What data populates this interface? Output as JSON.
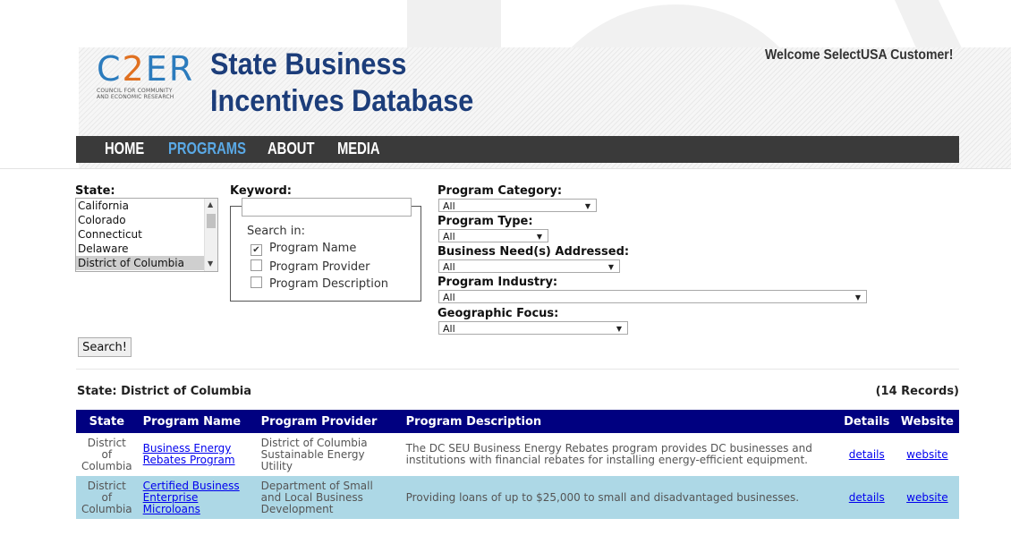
{
  "logo": {
    "letters_c": "C",
    "letters_2": "2",
    "letters_er": "ER",
    "subtitle_line1": "COUNCIL FOR COMMUNITY",
    "subtitle_line2": "AND ECONOMIC RESEARCH"
  },
  "header": {
    "title_line1": "State Business",
    "title_line2": "Incentives Database",
    "welcome": "Welcome SelectUSA Customer!"
  },
  "nav": {
    "items": [
      {
        "label": "HOME",
        "active": false
      },
      {
        "label": "PROGRAMS",
        "active": true
      },
      {
        "label": "ABOUT",
        "active": false
      },
      {
        "label": "MEDIA",
        "active": false
      }
    ]
  },
  "filters": {
    "state_label": "State:",
    "state_options": [
      "California",
      "Colorado",
      "Connecticut",
      "Delaware",
      "District of Columbia"
    ],
    "state_selected": "District of Columbia",
    "keyword_label": "Keyword:",
    "keyword_value": "",
    "search_in_label": "Search in:",
    "search_in": [
      {
        "label": "Program Name",
        "checked": true
      },
      {
        "label": "Program Provider",
        "checked": false
      },
      {
        "label": "Program Description",
        "checked": false
      }
    ],
    "program_category_label": "Program Category:",
    "program_category_value": "All",
    "program_type_label": "Program Type:",
    "program_type_value": "All",
    "business_need_label": "Business Need(s) Addressed:",
    "business_need_value": "All",
    "program_industry_label": "Program Industry:",
    "program_industry_value": "All",
    "geographic_focus_label": "Geographic Focus:",
    "geographic_focus_value": "All",
    "search_button": "Search!"
  },
  "results": {
    "state_heading": "State: District of Columbia",
    "record_count": "(14 Records)",
    "columns": [
      "State",
      "Program Name",
      "Program Provider",
      "Program Description",
      "Details",
      "Website"
    ],
    "rows": [
      {
        "state": "District of Columbia",
        "program_name": "Business Energy Rebates Program",
        "provider": "District of Columbia Sustainable Energy Utility",
        "description": "The DC SEU Business Energy Rebates program provides DC businesses and institutions with financial rebates for installing energy-efficient equipment.",
        "details": "details",
        "website": "website"
      },
      {
        "state": "District of Columbia",
        "program_name": "Certified Business Enterprise Microloans",
        "provider": "Department of Small and Local Business Development",
        "description": "Providing loans of up to $25,000 to small and disadvantaged businesses.",
        "details": "details",
        "website": "website"
      }
    ]
  },
  "colors": {
    "table_header": "#000080",
    "row_alt": "#add8e6",
    "nav_bg": "#3a3a3a",
    "nav_active": "#5aa9e6",
    "title": "#1c3d7a"
  }
}
